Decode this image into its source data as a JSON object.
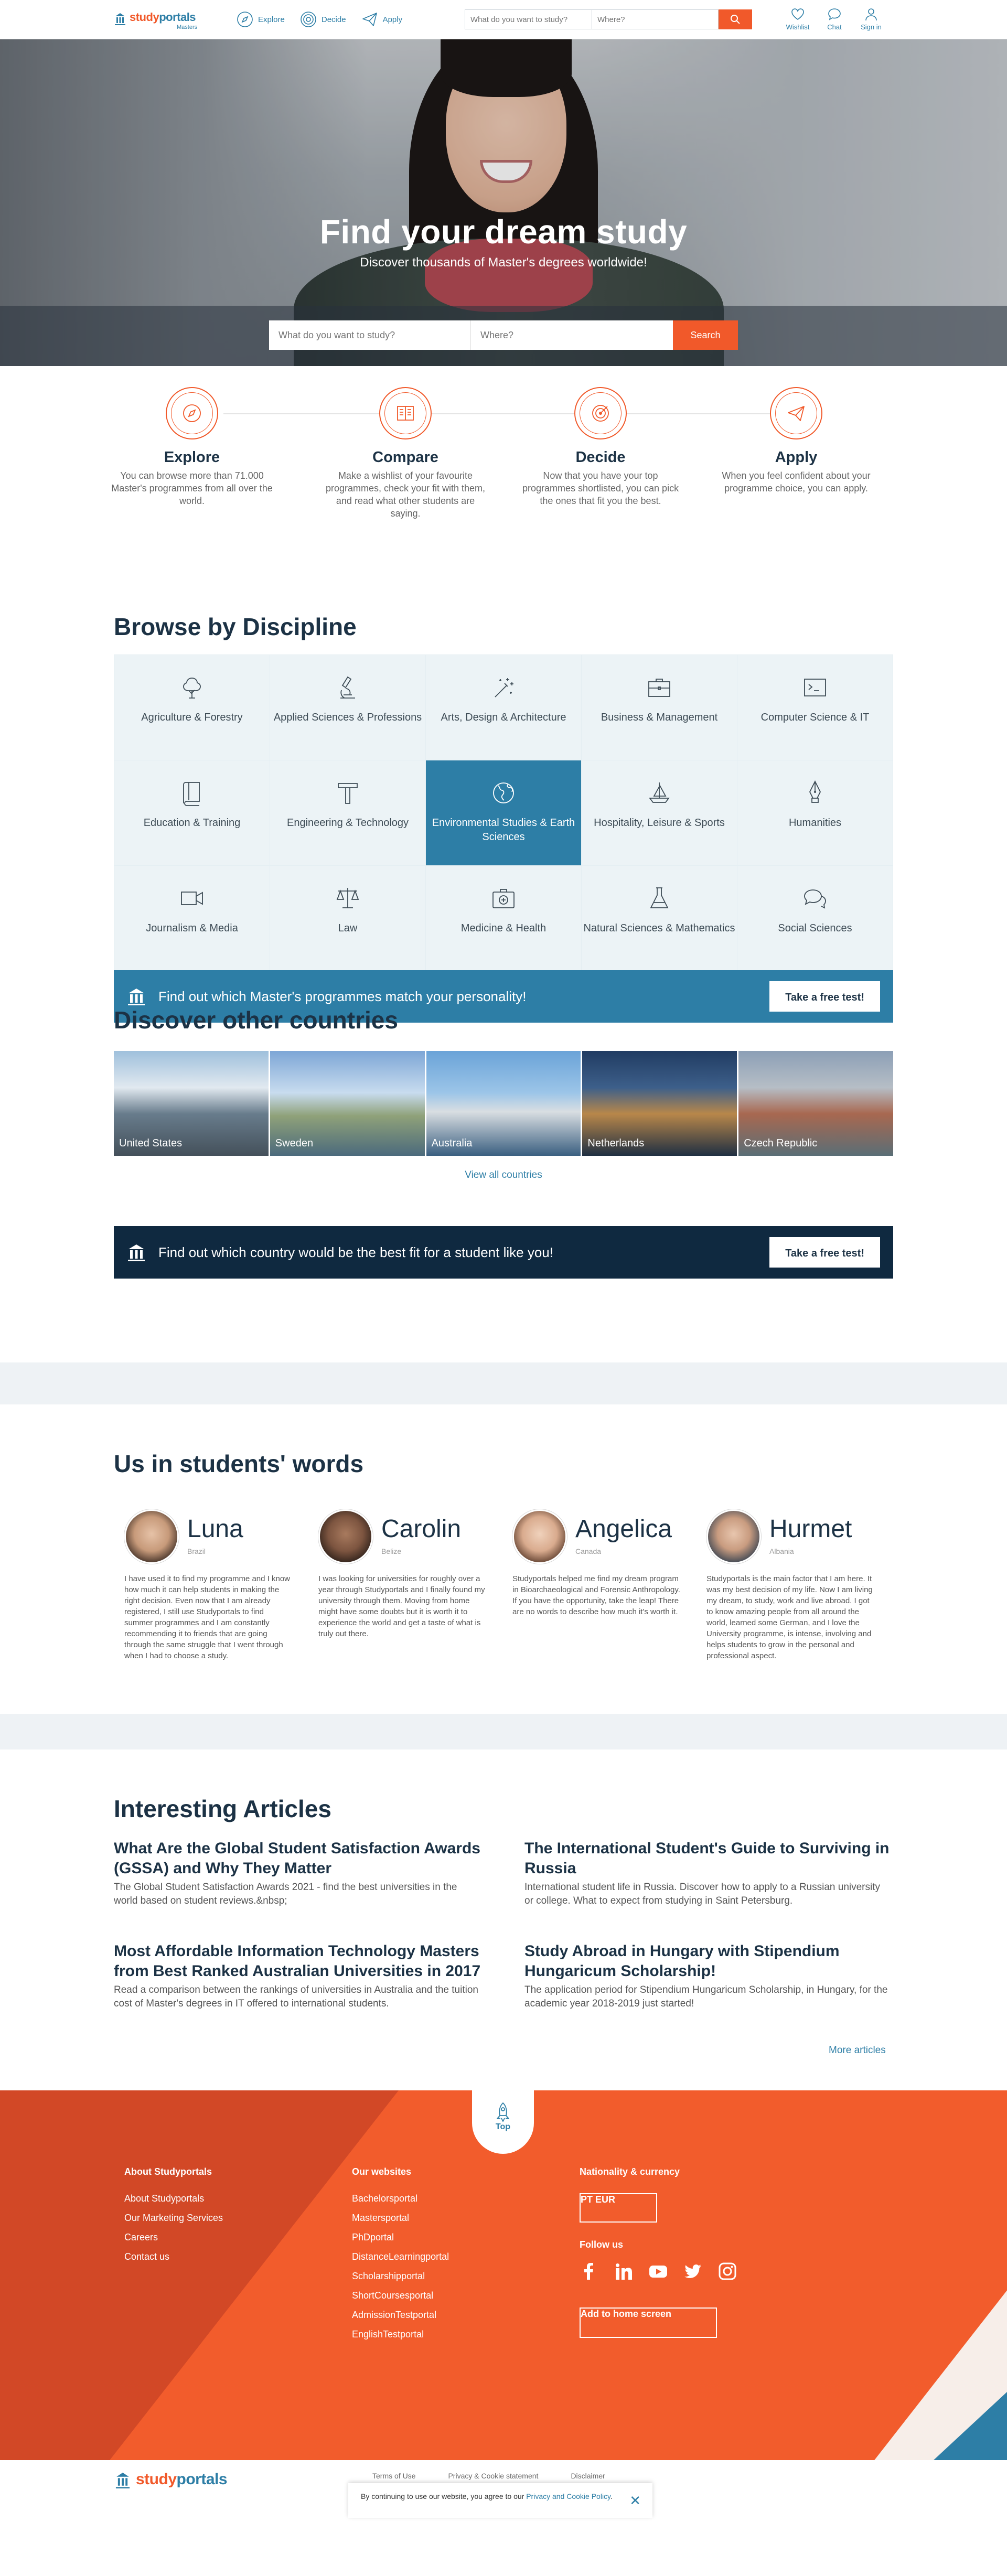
{
  "header": {
    "logo_name_a": "study",
    "logo_name_b": "portals",
    "logo_sub": "Masters",
    "nav": [
      {
        "label": "Explore",
        "icon": "compass-icon"
      },
      {
        "label": "Decide",
        "icon": "target-icon"
      },
      {
        "label": "Apply",
        "icon": "paper-plane-icon"
      }
    ],
    "search_what_placeholder": "What do you want to study?",
    "search_where_placeholder": "Where?",
    "icons": [
      {
        "label": "Wishlist",
        "icon": "heart-icon"
      },
      {
        "label": "Chat",
        "icon": "chat-icon"
      },
      {
        "label": "Sign in",
        "icon": "user-icon"
      }
    ]
  },
  "hero": {
    "title": "Find your dream study",
    "subtitle": "Discover thousands of Master's degrees worldwide!",
    "search_what_placeholder": "What do you want to study?",
    "search_where_placeholder": "Where?",
    "search_button": "Search"
  },
  "steps": [
    {
      "title": "Explore",
      "text": "You can browse more than 71.000 Master's programmes from all over the world.",
      "icon": "compass-icon"
    },
    {
      "title": "Compare",
      "text": "Make a wishlist of your favourite programmes, check your fit with them, and read what other students are saying.",
      "icon": "compare-icon"
    },
    {
      "title": "Decide",
      "text": "Now that you have your top programmes shortlisted, you can pick the ones that fit you the best.",
      "icon": "target-icon"
    },
    {
      "title": "Apply",
      "text": "When you feel confident about your programme choice, you can apply.",
      "icon": "paper-plane-icon"
    }
  ],
  "disciplines": {
    "title": "Browse by Discipline",
    "items": [
      {
        "label": "Agriculture & Forestry",
        "icon": "tree-icon"
      },
      {
        "label": "Applied Sciences & Professions",
        "icon": "microscope-icon"
      },
      {
        "label": "Arts, Design & Architecture",
        "icon": "magic-wand-icon"
      },
      {
        "label": "Business & Management",
        "icon": "briefcase-icon"
      },
      {
        "label": "Computer Science & IT",
        "icon": "terminal-icon"
      },
      {
        "label": "Education & Training",
        "icon": "book-icon"
      },
      {
        "label": "Engineering & Technology",
        "icon": "hammer-icon"
      },
      {
        "label": "Environmental Studies & Earth Sciences",
        "icon": "globe-icon"
      },
      {
        "label": "Hospitality, Leisure & Sports",
        "icon": "sailboat-icon"
      },
      {
        "label": "Humanities",
        "icon": "pen-nib-icon"
      },
      {
        "label": "Journalism & Media",
        "icon": "video-camera-icon"
      },
      {
        "label": "Law",
        "icon": "scales-icon"
      },
      {
        "label": "Medicine & Health",
        "icon": "first-aid-kit-icon"
      },
      {
        "label": "Natural Sciences & Mathematics",
        "icon": "flask-icon"
      },
      {
        "label": "Social Sciences",
        "icon": "chat-bubbles-icon"
      }
    ],
    "active_index": 7,
    "cta_text": "Find out which Master's programmes match your personality!",
    "cta_button": "Take a free test!"
  },
  "countries": {
    "title": "Discover other countries",
    "items": [
      "United States",
      "Sweden",
      "Australia",
      "Netherlands",
      "Czech Republic"
    ],
    "view_all": "View all countries",
    "cta_text": "Find out which country would be the best fit for a student like you!",
    "cta_button": "Take a free test!"
  },
  "testimonials": {
    "title": "Us in students' words",
    "people": [
      {
        "name": "Luna",
        "country": "Brazil",
        "text": "I have used it to find my programme and I know how much it can help students in making the right decision. Even now that I am already registered, I still use Studyportals to find summer programmes and I am constantly recommending it to friends that are going through the same struggle that I went through when I had to choose a study."
      },
      {
        "name": "Carolin",
        "country": "Belize",
        "text": "I was looking for universities for roughly over a year through Studyportals and I finally found my university through them. Moving from home might have some doubts but it is worth it to experience the world and get a taste of what is truly out there."
      },
      {
        "name": "Angelica",
        "country": "Canada",
        "text": "Studyportals helped me find my dream program in Bioarchaeological and Forensic Anthropology. If you have the opportunity, take the leap! There are no words to describe how much it's worth it."
      },
      {
        "name": "Hurmet",
        "country": "Albania",
        "text": "Studyportals is the main factor that I am here. It was my best decision of my life. Now I am living my dream, to study, work and live abroad. I got to know amazing people from all around the world, learned some German, and I love the University programme, is intense, involving and helps students to grow in the personal and professional aspect."
      }
    ]
  },
  "articles": {
    "title": "Interesting Articles",
    "items": [
      {
        "title": "What Are the Global Student Satisfaction Awards (GSSA) and Why They Matter",
        "text": "The Global Student Satisfaction Awards 2021 - find the best universities in the world based on student reviews.&nbsp;"
      },
      {
        "title": "The International Student's Guide to Surviving in Russia",
        "text": "International student life in Russia. Discover how to apply to a Russian university or college. What to expect from studying in Saint Petersburg."
      },
      {
        "title": "Most Affordable Information Technology Masters from Best Ranked Australian Universities in 2017",
        "text": "Read a comparison between the rankings of universities in Australia and the tuition cost of Master's degrees in IT offered to international students."
      },
      {
        "title": "Study Abroad in Hungary with Stipendium Hungaricum Scholarship!",
        "text": "The application period for Stipendium Hungaricum Scholarship, in Hungary, for the academic year 2018-2019 just started!"
      }
    ],
    "more": "More articles"
  },
  "footer": {
    "top_label": "Top",
    "about_title": "About Studyportals",
    "about_links": [
      "About Studyportals",
      "Our Marketing Services",
      "Careers",
      "Contact us"
    ],
    "websites_title": "Our websites",
    "websites": [
      "Bachelorsportal",
      "Mastersportal",
      "PhDportal",
      "DistanceLearningportal",
      "Scholarshipportal",
      "ShortCoursesportal",
      "AdmissionTestportal",
      "EnglishTestportal"
    ],
    "nationality_title": "Nationality & currency",
    "nationality": "PT",
    "currency": "EUR",
    "follow_title": "Follow us",
    "socials": [
      "facebook-icon",
      "linkedin-icon",
      "youtube-icon",
      "twitter-icon",
      "instagram-icon"
    ],
    "home_button": "Add to home screen"
  },
  "bottom": {
    "logo_name_a": "study",
    "logo_name_b": "portals",
    "links": [
      "Terms of Use",
      "Privacy & Cookie statement",
      "Disclaimer"
    ],
    "cookie_text": "By continuing to use our website, you agree to our ",
    "cookie_link": "Privacy and Cookie Policy",
    "cookie_end": "."
  },
  "colors": {
    "brand_blue": "#2d7ea6",
    "brand_orange": "#f1592a",
    "dark_navy": "#0f2940",
    "heading": "#1c3245"
  }
}
